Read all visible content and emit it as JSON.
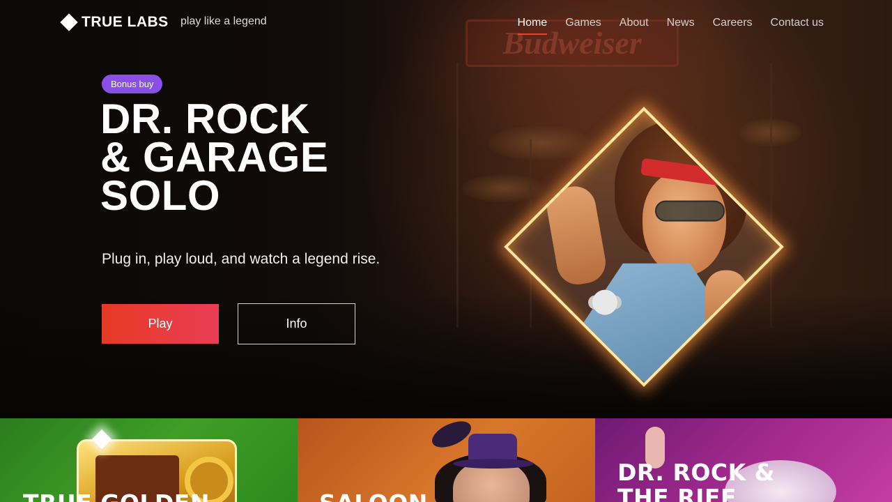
{
  "header": {
    "logo_text": "TRUE LABS",
    "tagline": "play like a legend",
    "nav": [
      {
        "label": "Home",
        "active": true
      },
      {
        "label": "Games",
        "active": false
      },
      {
        "label": "About",
        "active": false
      },
      {
        "label": "News",
        "active": false
      },
      {
        "label": "Careers",
        "active": false
      },
      {
        "label": "Contact us",
        "active": false
      }
    ]
  },
  "hero": {
    "badge": "Bonus buy",
    "title_lines": [
      "DR. ROCK",
      "& GARAGE",
      "SOLO"
    ],
    "subtitle": "Plug in, play loud, and watch a legend rise.",
    "play_label": "Play",
    "info_label": "Info",
    "background_sign": "Budweiser"
  },
  "cards": [
    {
      "title_lines": [
        "TRUE GOLDEN"
      ],
      "color": "#3a9a24"
    },
    {
      "title_lines": [
        "SALOON"
      ],
      "color": "#d06a26"
    },
    {
      "title_lines": [
        "DR. ROCK &",
        "THE RIFF"
      ],
      "color": "#a52a8e"
    }
  ],
  "colors": {
    "accent": "#e8432e",
    "badge": "#8a4fe6",
    "play_gradient_start": "#e63a25",
    "play_gradient_end": "#ea3d55"
  }
}
